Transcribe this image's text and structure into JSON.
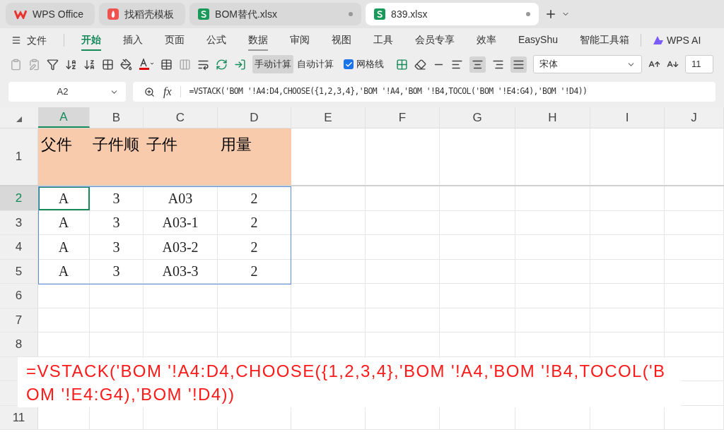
{
  "tabs": [
    {
      "label": "WPS Office",
      "kind": "wps",
      "selected": false
    },
    {
      "label": "找稻壳模板",
      "kind": "template",
      "selected": false
    },
    {
      "label": "BOM替代.xlsx",
      "kind": "sheet",
      "selected": false
    },
    {
      "label": "839.xlsx",
      "kind": "sheet",
      "selected": true
    }
  ],
  "menu": {
    "file": "文件",
    "items": [
      {
        "label": "开始",
        "selected": true,
        "hovered": false
      },
      {
        "label": "插入",
        "selected": false,
        "hovered": false
      },
      {
        "label": "页面",
        "selected": false,
        "hovered": false
      },
      {
        "label": "公式",
        "selected": false,
        "hovered": false
      },
      {
        "label": "数据",
        "selected": false,
        "hovered": true
      },
      {
        "label": "审阅",
        "selected": false,
        "hovered": false
      },
      {
        "label": "视图",
        "selected": false,
        "hovered": false
      },
      {
        "label": "工具",
        "selected": false,
        "hovered": false
      },
      {
        "label": "会员专享",
        "selected": false,
        "hovered": false
      },
      {
        "label": "效率",
        "selected": false,
        "hovered": false
      },
      {
        "label": "EasyShu",
        "selected": false,
        "hovered": false
      },
      {
        "label": "智能工具箱",
        "selected": false,
        "hovered": false
      }
    ],
    "ai": "WPS AI"
  },
  "toolbar": {
    "calc_buttons": [
      {
        "label": "手动计算",
        "selected": true
      },
      {
        "label": "自动计算",
        "selected": false
      }
    ],
    "gridlines": {
      "label": "网格线",
      "checked": true
    },
    "font": "宋体",
    "font_size": "11"
  },
  "formula_bar": {
    "name_box": "A2",
    "fx": "fx",
    "formula": "=VSTACK('BOM '!A4:D4,CHOOSE({1,2,3,4},'BOM '!A4,'BOM '!B4,TOCOL('BOM '!E4:G4),'BOM '!D4))"
  },
  "sheet": {
    "columns": [
      {
        "label": "A",
        "selected": true
      },
      {
        "label": "B",
        "selected": false
      },
      {
        "label": "C",
        "selected": false
      },
      {
        "label": "D",
        "selected": false
      },
      {
        "label": "E",
        "selected": false
      },
      {
        "label": "F",
        "selected": false
      },
      {
        "label": "G",
        "selected": false
      },
      {
        "label": "H",
        "selected": false
      },
      {
        "label": "I",
        "selected": false
      },
      {
        "label": "J",
        "selected": false
      }
    ],
    "rows": [
      {
        "label": "1",
        "selected": false,
        "kind": "header",
        "cells": [
          "父件",
          "子件顺",
          "子件",
          "用量"
        ]
      },
      {
        "label": "2",
        "selected": true,
        "kind": "data",
        "cells": [
          "A",
          "3",
          "A03",
          "2"
        ]
      },
      {
        "label": "3",
        "selected": false,
        "kind": "data",
        "cells": [
          "A",
          "3",
          "A03-1",
          "2"
        ]
      },
      {
        "label": "4",
        "selected": false,
        "kind": "data",
        "cells": [
          "A",
          "3",
          "A03-2",
          "2"
        ]
      },
      {
        "label": "5",
        "selected": false,
        "kind": "data",
        "cells": [
          "A",
          "3",
          "A03-3",
          "2"
        ]
      },
      {
        "label": "6",
        "selected": false,
        "kind": "empty"
      },
      {
        "label": "7",
        "selected": false,
        "kind": "empty"
      },
      {
        "label": "8",
        "selected": false,
        "kind": "empty"
      },
      {
        "selected": false,
        "kind": "empty"
      },
      {
        "selected": false,
        "kind": "empty"
      },
      {
        "label": "11",
        "selected": false,
        "kind": "empty"
      }
    ]
  },
  "callout": "=VSTACK('BOM '!A4:D4,CHOOSE({1,2,3,4},'BOM '!A4,'BOM '!B4,TOCOL('BOM '!E4:G4),'BOM '!D4))"
}
